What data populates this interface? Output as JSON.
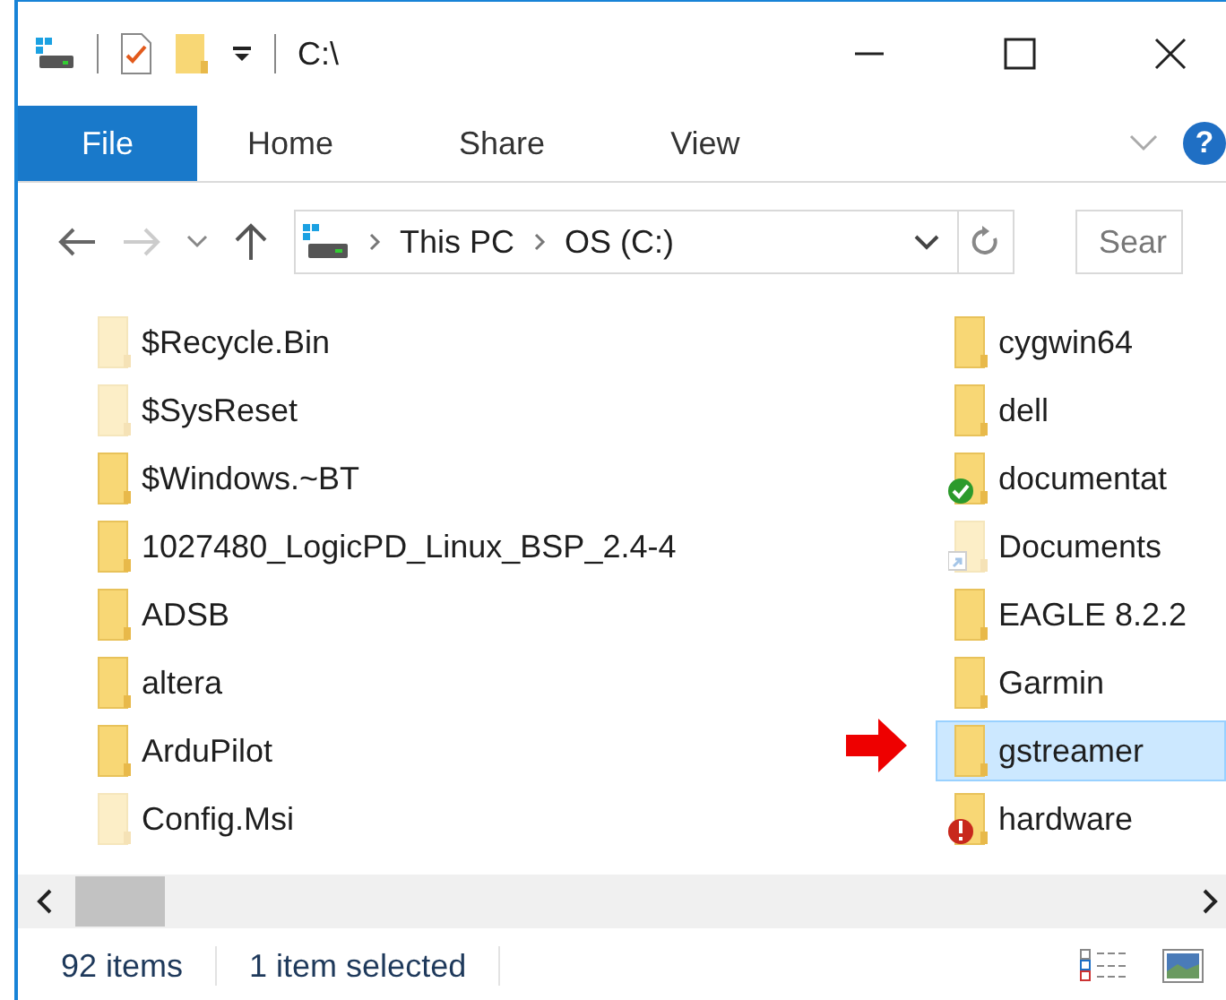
{
  "window": {
    "title": "C:\\"
  },
  "ribbon": {
    "tabs": [
      {
        "label": "File",
        "selected": true
      },
      {
        "label": "Home",
        "selected": false
      },
      {
        "label": "Share",
        "selected": false
      },
      {
        "label": "View",
        "selected": false
      }
    ],
    "help": "?"
  },
  "address": {
    "crumbs": [
      "This PC",
      "OS (C:)"
    ],
    "search_placeholder": "Sear"
  },
  "columns": [
    {
      "items": [
        {
          "name": "$Recycle.Bin",
          "hidden": true,
          "selected": false
        },
        {
          "name": "$SysReset",
          "hidden": true,
          "selected": false
        },
        {
          "name": "$Windows.~BT",
          "hidden": false,
          "selected": false
        },
        {
          "name": "1027480_LogicPD_Linux_BSP_2.4-4",
          "hidden": false,
          "selected": false
        },
        {
          "name": "ADSB",
          "hidden": false,
          "selected": false
        },
        {
          "name": "altera",
          "hidden": false,
          "selected": false
        },
        {
          "name": "ArduPilot",
          "hidden": false,
          "selected": false
        },
        {
          "name": "Config.Msi",
          "hidden": true,
          "selected": false
        }
      ]
    },
    {
      "items": [
        {
          "name": "cygwin64",
          "hidden": false,
          "selected": false
        },
        {
          "name": "dell",
          "hidden": false,
          "selected": false
        },
        {
          "name": "documentat",
          "hidden": false,
          "selected": false,
          "kind": "synced"
        },
        {
          "name": "Documents",
          "hidden": true,
          "selected": false,
          "kind": "shortcut"
        },
        {
          "name": "EAGLE 8.2.2",
          "hidden": false,
          "selected": false
        },
        {
          "name": "Garmin",
          "hidden": false,
          "selected": false
        },
        {
          "name": "gstreamer",
          "hidden": false,
          "selected": true,
          "pointer": true
        },
        {
          "name": "hardware",
          "hidden": false,
          "selected": false,
          "kind": "error"
        }
      ]
    }
  ],
  "status_bar": {
    "count": "92 items",
    "selection": "1 item selected"
  }
}
